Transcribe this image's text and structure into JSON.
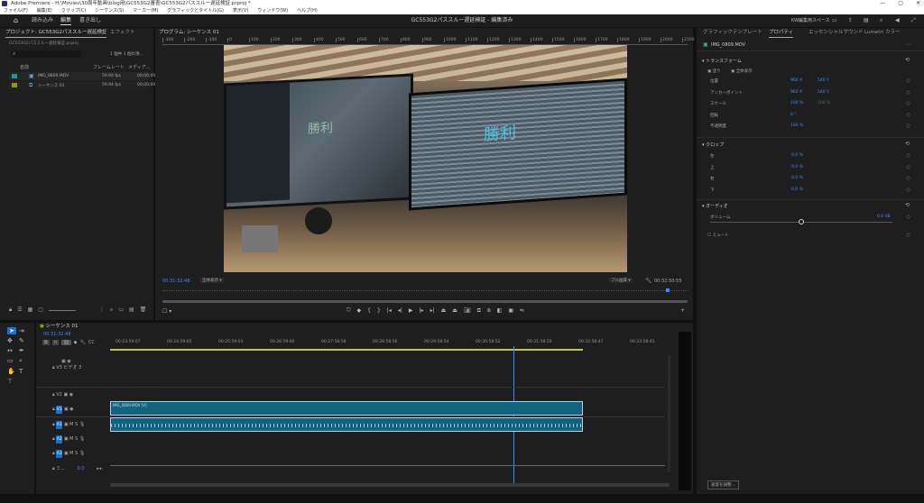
{
  "window": {
    "title": "Adobe Premiere - H:\\Movies\\30周年動画\\blog用\\GC553G2審査\\GC553G2パススルー遅延検証.prproj *",
    "controls": [
      "—",
      "▢",
      "✕"
    ]
  },
  "menu": [
    "ファイル(F)",
    "編集(E)",
    "クリップ(C)",
    "シーケンス(S)",
    "マーカー(M)",
    "グラフィックとタイトル(G)",
    "表示(V)",
    "ウィンドウ(W)",
    "ヘルプ(H)"
  ],
  "header": {
    "tabs": [
      "読み込み",
      "編集",
      "書き出し"
    ],
    "active_tab": 1,
    "doc_title": "GC553G2パススルー遅延検証 - 編集済み",
    "workspace": "KW編集用スペース"
  },
  "project": {
    "tab": "プロジェクト: GC553G2パススルー遅延検証",
    "tab2": "エフェクト",
    "file": "GC553G2パススルー遅延検証.prproj",
    "selection": "1 個中 1 個の項...",
    "columns": [
      "名前",
      "フレームレート",
      "メディア..."
    ],
    "items": [
      {
        "name": "IMG_0809.MOV",
        "fps": "59.94 fps",
        "media": "00;00;00",
        "color": "#2a8fa0"
      },
      {
        "name": "シーケンス 01",
        "fps": "59.94 fps",
        "media": "00;00;00",
        "color": "#8a9a20"
      }
    ]
  },
  "program": {
    "tab": "プログラム: シーケンス 01",
    "ruler": [
      "-300",
      "-200",
      "-100",
      "0",
      "100",
      "200",
      "300",
      "400",
      "500",
      "600",
      "700",
      "800",
      "900",
      "1000",
      "1100",
      "1200",
      "1300",
      "1400",
      "1500",
      "1600",
      "1700",
      "1800",
      "1900",
      "2000",
      "2100"
    ],
    "timecode": "00:31:32:48",
    "fit": "全体表示",
    "quality": "フル画質",
    "duration": "00:32:50:55",
    "overlay_text_left": "勝利",
    "overlay_text_right": "勝利"
  },
  "properties": {
    "tabs": [
      "グラフィックテンプレート",
      "プロパティ",
      "エッセンシャルサウンド",
      "Lumetri カラー"
    ],
    "active_tab": 1,
    "clip": "IMG_0809.MOV",
    "transform": {
      "title": "トランスフォーム",
      "fill": "塗り",
      "fit_all": "全体表示",
      "rows": [
        {
          "label": "位置",
          "v1": "960 X",
          "v2": "540 Y"
        },
        {
          "label": "アンカーポイント",
          "v1": "960 X",
          "v2": "540 Y"
        },
        {
          "label": "スケール",
          "v1": "100 %",
          "v2": "100 %"
        },
        {
          "label": "回転",
          "v1": "0 °",
          "v2": ""
        },
        {
          "label": "不透明度",
          "v1": "100 %",
          "v2": ""
        }
      ]
    },
    "crop": {
      "title": "クロップ",
      "rows": [
        {
          "label": "左",
          "v": "0.0 %"
        },
        {
          "label": "上",
          "v": "0.0 %"
        },
        {
          "label": "右",
          "v": "0.0 %"
        },
        {
          "label": "下",
          "v": "0.0 %"
        }
      ]
    },
    "audio": {
      "title": "オーディオ",
      "volume_label": "ボリューム",
      "volume": "0.0 dB",
      "volume_slider": 0.5,
      "mute": "ミュート"
    },
    "adjust_button": "速度を調整..."
  },
  "timeline": {
    "tab": "シーケンス 01",
    "timecode": "00:31:32:48",
    "ruler": [
      "00:23:59:07",
      "00:24:59:05",
      "00:25:59:03",
      "00:26:59:00",
      "00:27:58:58",
      "00:28:58:56",
      "00:29:58:54",
      "00:30:58:52",
      "00:31:58:50",
      "00:32:58:47",
      "00:33:58:45"
    ],
    "playhead_fraction": 0.79,
    "tracks": {
      "v3": "V3",
      "v3_name": "ビデオ 3",
      "v2": "V2",
      "v1": "V1",
      "a1": "A1",
      "a2": "A2",
      "a3": "A3",
      "mix": "ミ...",
      "mix_value": "0.0"
    },
    "clip_label": "IMG_0809.MOV [V]"
  },
  "colors": {
    "accent": "#3d8bff",
    "clip": "#12647e",
    "track_target": "#1a6fd8",
    "work_area": "#c8c23a"
  }
}
